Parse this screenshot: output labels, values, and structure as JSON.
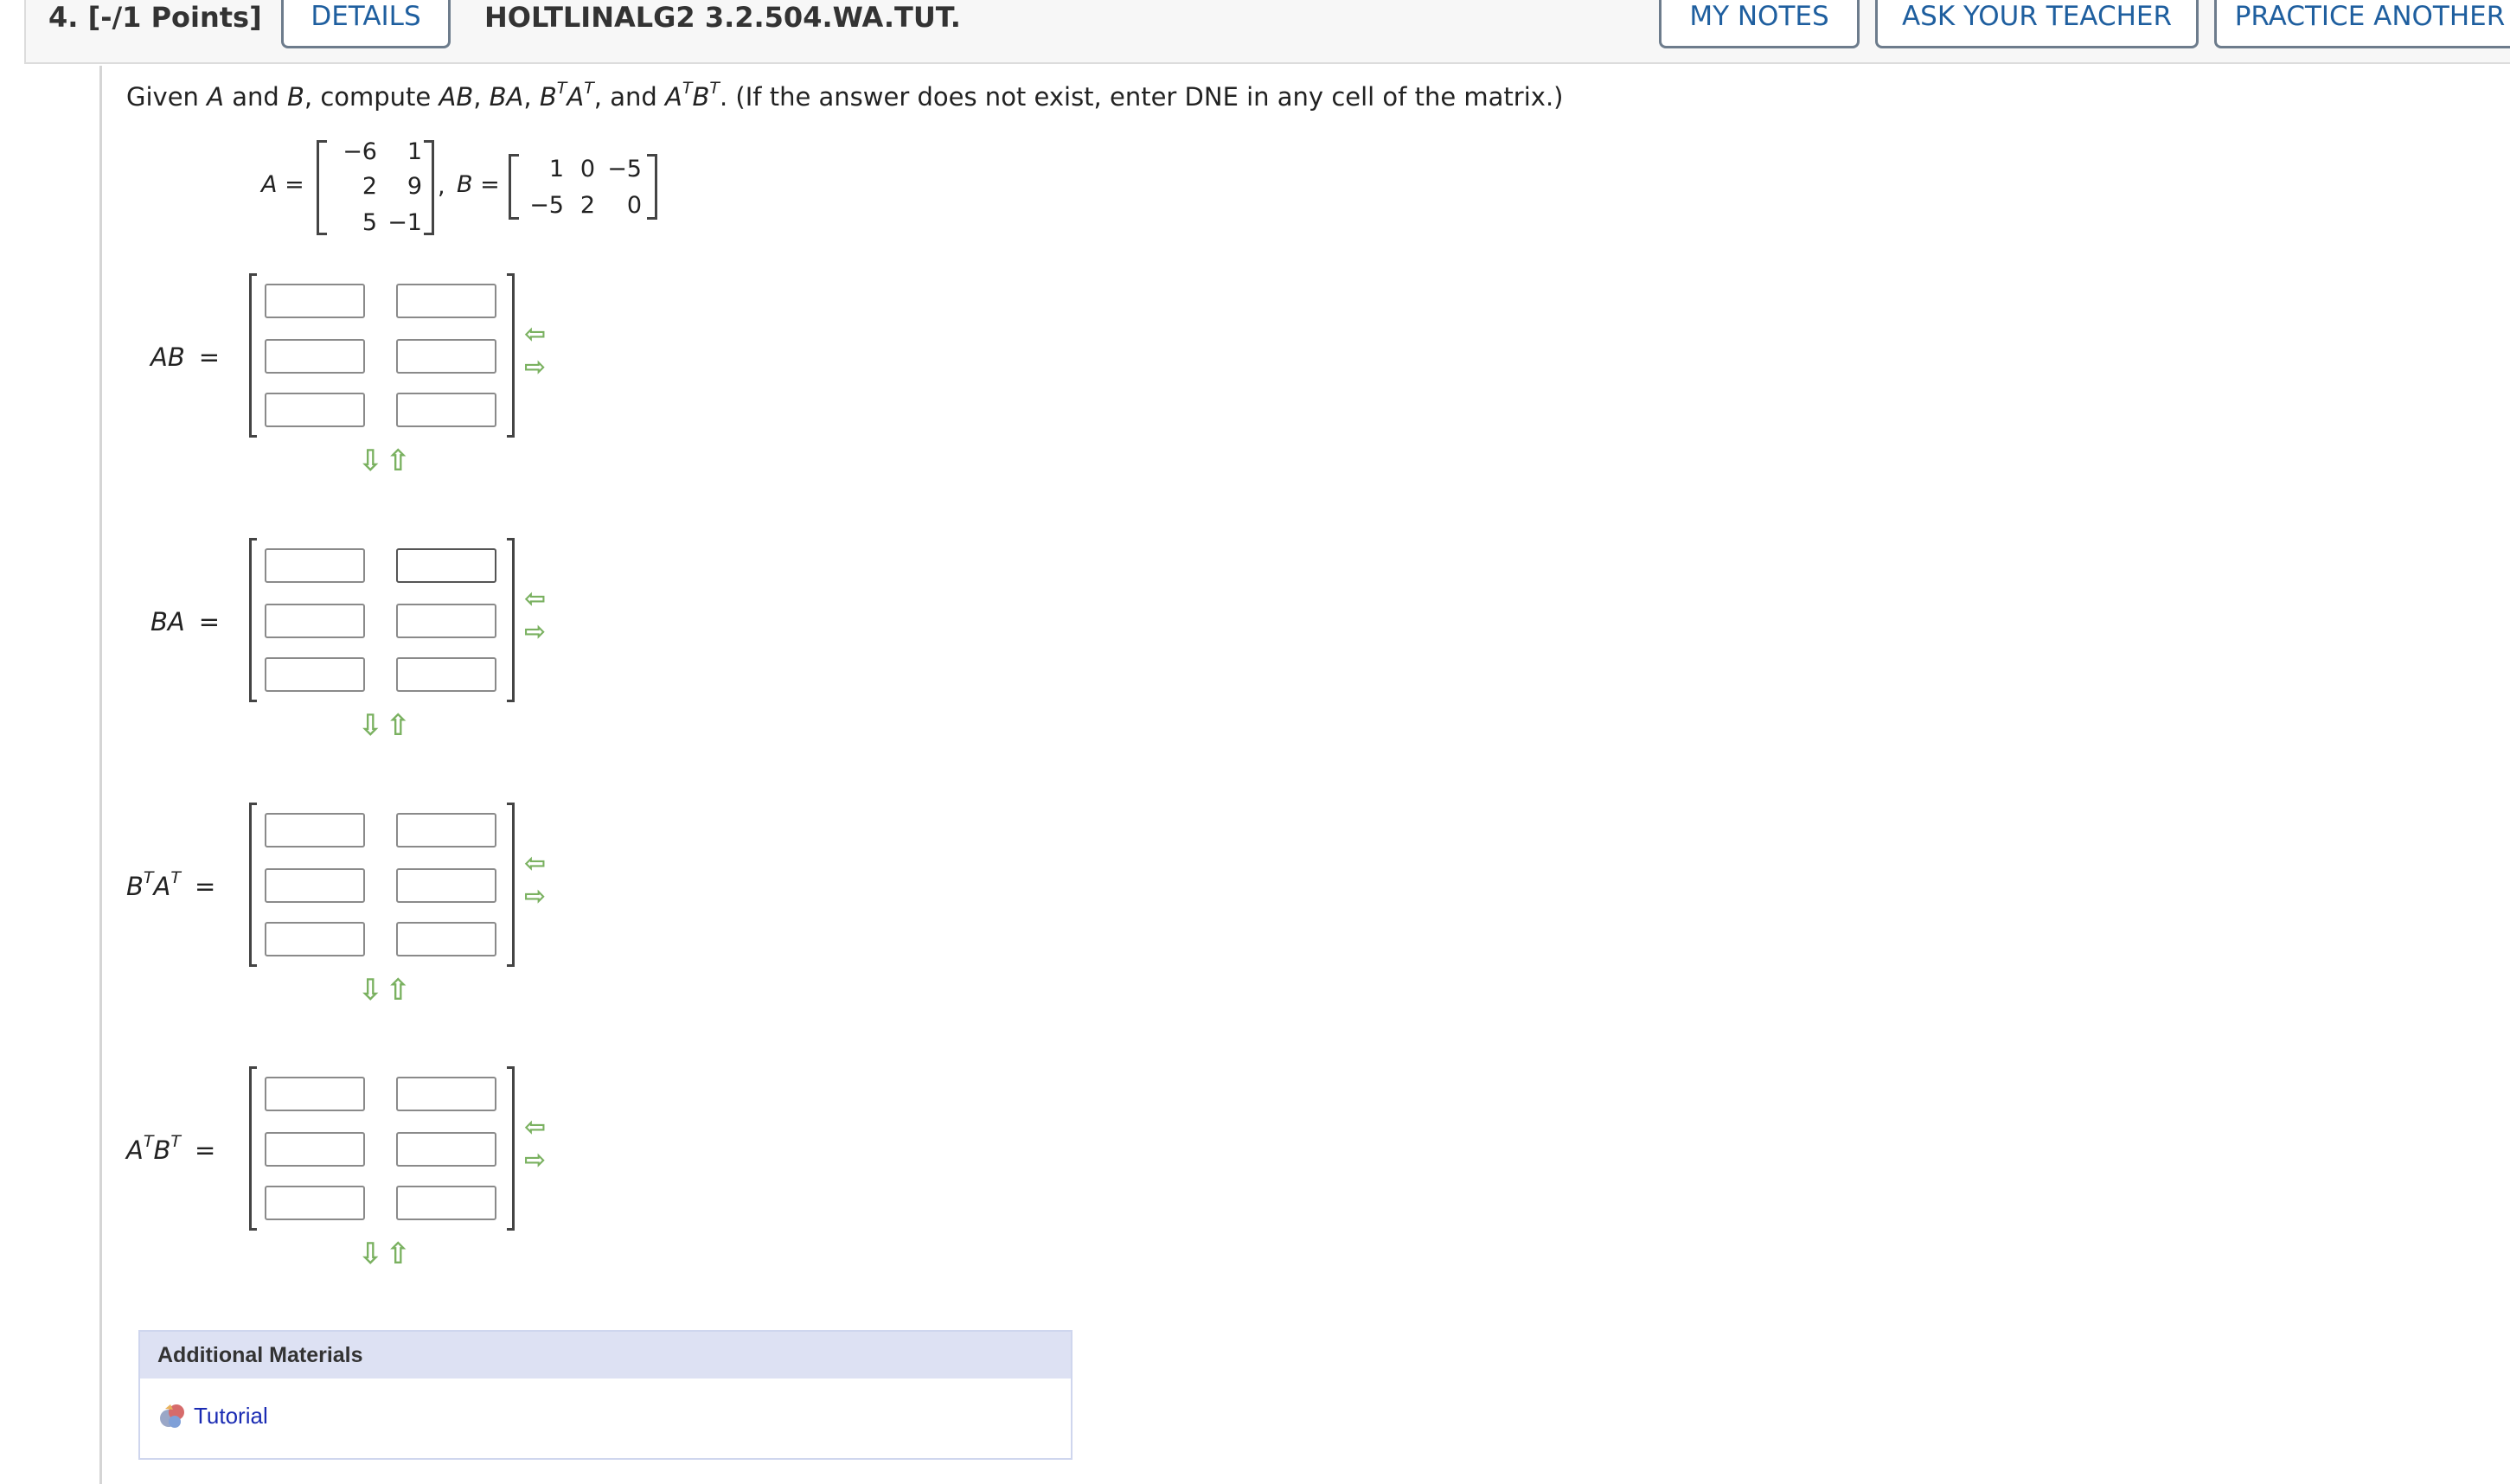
{
  "header": {
    "question_number": "4. [-/1 Points]",
    "details_label": "DETAILS",
    "question_id": "HOLTLINALG2 3.2.504.WA.TUT.",
    "my_notes_label": "MY NOTES",
    "ask_teacher_label": "ASK YOUR TEACHER",
    "practice_label": "PRACTICE ANOTHER"
  },
  "question": {
    "intro": "Given ",
    "A": "A",
    "and": " and ",
    "B": "B",
    "compute": ", compute ",
    "AB": "AB",
    "sep": ", ",
    "BA": "BA",
    "BT": "B",
    "AT": "A",
    "T": "T",
    "and2": ", and ",
    "period": ". ",
    "note": "(If the answer does not exist, enter DNE in any cell of the matrix.)"
  },
  "given": {
    "A_label": "A",
    "B_label": "B",
    "eq": "=",
    "comma": ",",
    "A": [
      [
        "−6",
        "1"
      ],
      [
        "2",
        "9"
      ],
      [
        "5",
        "−1"
      ]
    ],
    "B": [
      [
        "1",
        "0",
        "−5"
      ],
      [
        "−5",
        "2",
        "0"
      ]
    ]
  },
  "answers": [
    {
      "label_base": "AB",
      "sup1": "",
      "base2": "",
      "sup2": "",
      "eq": "=",
      "rows": 3,
      "cols": 2
    },
    {
      "label_base": "BA",
      "sup1": "",
      "base2": "",
      "sup2": "",
      "eq": "=",
      "rows": 3,
      "cols": 2
    },
    {
      "label_base": "B",
      "sup1": "T",
      "base2": "A",
      "sup2": "T",
      "eq": "=",
      "rows": 3,
      "cols": 2
    },
    {
      "label_base": "A",
      "sup1": "T",
      "base2": "B",
      "sup2": "T",
      "eq": "=",
      "rows": 3,
      "cols": 2
    }
  ],
  "arrows": {
    "left": "⇦",
    "right": "⇨",
    "down": "⇩",
    "up": "⇧"
  },
  "additional_materials": {
    "heading": "Additional Materials",
    "tutorial_label": "Tutorial",
    "tutorial_icon": "tutorial-icon"
  }
}
